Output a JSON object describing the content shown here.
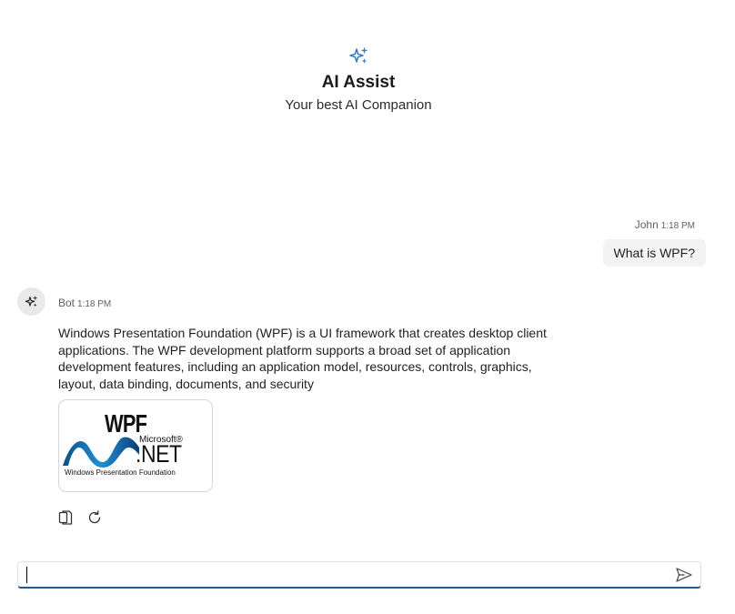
{
  "header": {
    "icon": "sparkles-icon",
    "title": "AI Assist",
    "subtitle": "Your best AI Companion"
  },
  "colors": {
    "accent": "#3b7fc4",
    "input_underline": "#1e5a8a",
    "bubble_bg": "#f3f3f3",
    "avatar_bg": "#e9e9e9"
  },
  "messages": {
    "user": {
      "author": "John",
      "time": "1:18 PM",
      "text": "What is WPF?"
    },
    "bot": {
      "author": "Bot",
      "time": "1:18 PM",
      "text": "Windows Presentation Foundation (WPF) is a UI framework that creates desktop client applications. The WPF development platform supports a broad set of application development features, including an application model, resources, controls, graphics, layout, data binding, documents, and security",
      "image": {
        "title": "WPF",
        "brand": "Microsoft®",
        "product": ".NET",
        "caption": "Windows Presentation Foundation"
      },
      "actions": [
        "copy-icon",
        "refresh-icon"
      ]
    }
  },
  "composer": {
    "value": "",
    "placeholder": "",
    "send_icon": "send-icon"
  }
}
